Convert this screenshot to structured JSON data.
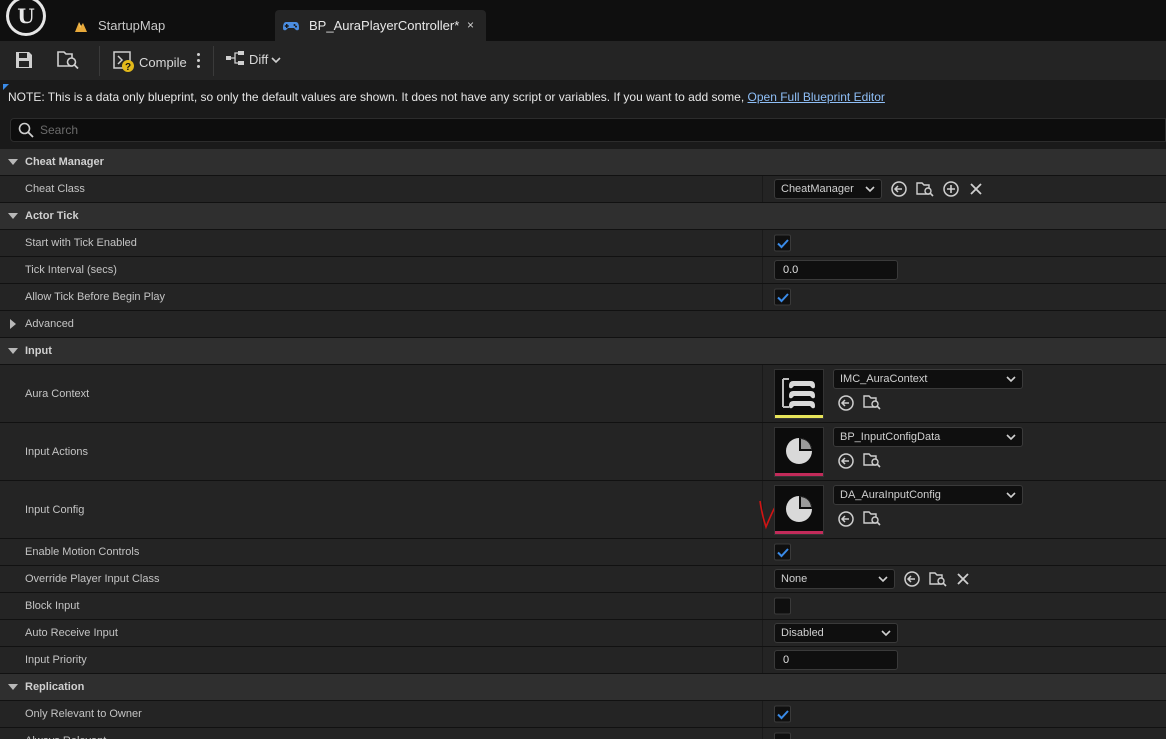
{
  "tabs": [
    {
      "label": "StartupMap",
      "icon": "map-icon"
    },
    {
      "label": "BP_AuraPlayerController*",
      "icon": "gamepad-icon",
      "close": "×"
    }
  ],
  "toolbar": {
    "compile_label": "Compile",
    "diff_label": "Diff"
  },
  "note": {
    "text": "NOTE: This is a data only blueprint, so only the default values are shown.  It does not have any script or variables.  If you want to add some, ",
    "link": "Open Full Blueprint Editor"
  },
  "search": {
    "placeholder": "Search"
  },
  "sections": {
    "cheat_manager": {
      "title": "Cheat Manager",
      "cheat_class_label": "Cheat Class",
      "cheat_class_value": "CheatManager"
    },
    "actor_tick": {
      "title": "Actor Tick",
      "start_with_tick_label": "Start with Tick Enabled",
      "start_with_tick_checked": true,
      "tick_interval_label": "Tick Interval (secs)",
      "tick_interval_value": "0.0",
      "allow_tick_label": "Allow Tick Before Begin Play",
      "allow_tick_checked": true,
      "advanced_label": "Advanced"
    },
    "input": {
      "title": "Input",
      "aura_context_label": "Aura Context",
      "aura_context_value": "IMC_AuraContext",
      "input_actions_label": "Input Actions",
      "input_actions_value": "BP_InputConfigData",
      "input_config_label": "Input Config",
      "input_config_value": "DA_AuraInputConfig",
      "enable_motion_label": "Enable Motion Controls",
      "enable_motion_checked": true,
      "override_class_label": "Override Player Input Class",
      "override_class_value": "None",
      "block_input_label": "Block Input",
      "block_input_checked": false,
      "auto_receive_label": "Auto Receive Input",
      "auto_receive_value": "Disabled",
      "input_priority_label": "Input Priority",
      "input_priority_value": "0"
    },
    "replication": {
      "title": "Replication",
      "only_relevant_label": "Only Relevant to Owner",
      "only_relevant_checked": true,
      "always_relevant_label": "Always Relevant"
    }
  },
  "colors": {
    "accent": "#3a8be8",
    "check": "#3a8be8",
    "context_bar": "#e6e35a",
    "data_bar": "#c22b5a",
    "annotation": "#d11414"
  }
}
